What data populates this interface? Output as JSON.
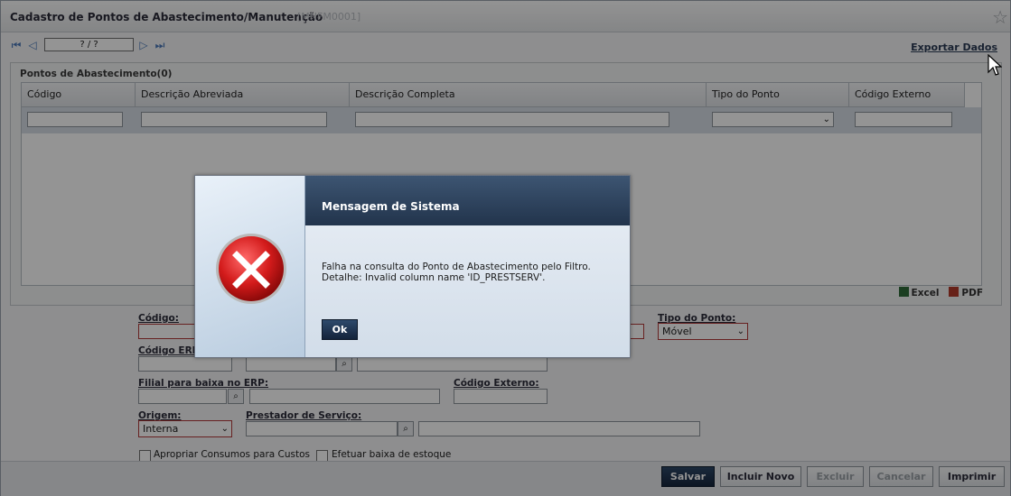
{
  "window": {
    "title": "Cadastro de Pontos de Abastecimento/Manutenção",
    "code": "[MNFM0001]"
  },
  "nav": {
    "page_indicator": "? / ?",
    "export_label": "Exportar Dados"
  },
  "grid": {
    "title": "Pontos de Abastecimento(0)",
    "columns": [
      "Código",
      "Descrição Abreviada",
      "Descrição Completa",
      "Tipo do Ponto",
      "Código Externo"
    ],
    "export_excel": "Excel",
    "export_pdf": "PDF"
  },
  "form": {
    "codigo_label": "Código:",
    "tipo_ponto_label": "Tipo do Ponto:",
    "tipo_ponto_value": "Móvel",
    "codigo_erp_label": "Código ERP:",
    "filial_label": "Filial para baixa no ERP:",
    "codigo_externo_label": "Código Externo:",
    "origem_label": "Origem:",
    "origem_value": "Interna",
    "prestador_label": "Prestador de Serviço:",
    "chk_apropriar": "Apropriar Consumos para Custos",
    "chk_baixa": "Efetuar baixa de estoque"
  },
  "buttons": {
    "salvar": "Salvar",
    "incluir_novo": "Incluir Novo",
    "excluir": "Excluir",
    "cancelar": "Cancelar",
    "imprimir": "Imprimir"
  },
  "dialog": {
    "title": "Mensagem de Sistema",
    "line1": "Falha na consulta do Ponto de Abastecimento pelo Filtro.",
    "line2": "Detalhe: Invalid column name 'ID_PRESTSERV'.",
    "ok_label": "Ok",
    "icon": "error-x-icon"
  },
  "colors": {
    "accent_dark": "#22344c",
    "error_red": "#d32020",
    "required_border": "#b23a3a"
  }
}
